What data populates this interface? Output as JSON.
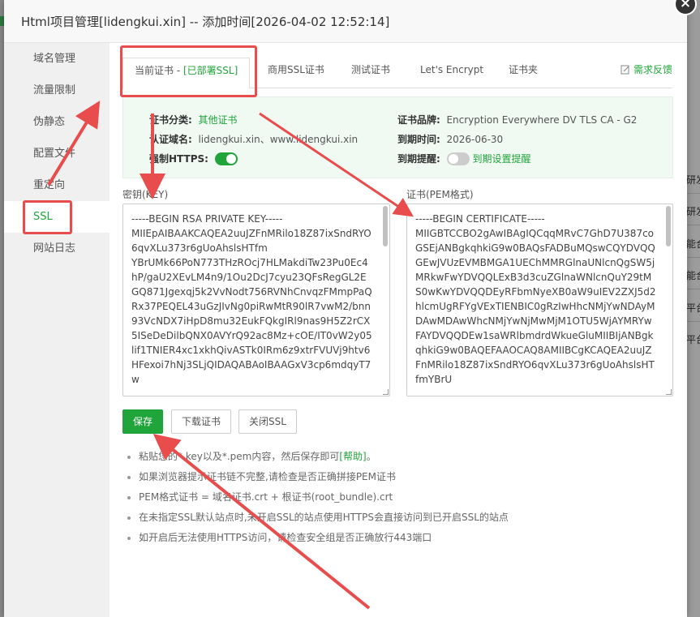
{
  "dialog": {
    "title": "Html项目管理[lidengkui.xin] -- 添加时间[2026-04-02 12:52:14]",
    "close_symbol": "×"
  },
  "sidebar": {
    "items": [
      {
        "label": "域名管理"
      },
      {
        "label": "流量限制"
      },
      {
        "label": "伪静态"
      },
      {
        "label": "配置文件"
      },
      {
        "label": "重定向"
      },
      {
        "label": "SSL"
      },
      {
        "label": "网站日志"
      }
    ],
    "active_index": 5
  },
  "tabs": {
    "current_prefix": "当前证书 - ",
    "current_status": "[已部署SSL]",
    "items": [
      {
        "label": "商用SSL证书"
      },
      {
        "label": "测试证书"
      },
      {
        "label": "Let's Encrypt"
      },
      {
        "label": "证书夹"
      }
    ],
    "feedback": "需求反馈"
  },
  "cert_info": {
    "category_label": "证书分类:",
    "category_value": "其他证书",
    "brand_label": "证书品牌:",
    "brand_value": "Encryption Everywhere DV TLS CA - G2",
    "domains_label": "认证域名:",
    "domains_value": "lidengkui.xin、www.lidengkui.xin",
    "expiry_label": "到期时间:",
    "expiry_value": "2026-06-30",
    "force_https_label": "强制HTTPS:",
    "force_https_on": true,
    "reminder_label": "到期提醒:",
    "reminder_on": false,
    "reminder_link": "到期设置提醒"
  },
  "key_field": {
    "label": "密钥(KEY)",
    "content": "-----BEGIN RSA PRIVATE KEY-----\nMIIEpAIBAAKCAQEA2uuJZFnMRilo18Z87ixSndRYO6qvXLu373r6gUoAhslsHTfm\nYBrUMk66PoN773THzROcj7HLMakdiTw23Pu0Ec4hP/gaU2XEvLM4n9/1Ou2DcJ7cyu23QFsRegGL2EGQ871Jgexqj5k2VvNodt756RVNhCnvqzFMmpPaQRx37PEQEL43uGzJIvNg0piRwMtR90lR7vwM2/bnn93VcNDX7iHpD8mu32EukFQkgIRl9nas9H5Z2rCX5ISeDeDilbQNX0AVYrQ92ac8Mz+cOE/IT0vW2y05lif1TNIER4xc1xkhQivASTk0IRm6z9xtrFVUVj9htv6HFexoi7hNj3SLjQIDAQABAoIBAAGxV3cp6mdqyT7w"
  },
  "cert_field": {
    "label": "证书(PEM格式)",
    "content": "-----BEGIN CERTIFICATE-----\nMIIGBTCCBO2gAwIBAgIQCqqMRvC7GhD7U387coGSEjANBgkqhkiG9w0BAQsFADBuMQswCQYDVQQGEwJVUzEVMBMGA1UEChMMRGlnaUNlcnQgSW5jMRkwFwYDVQQLExB3d3cuZGlnaWNlcnQuY29tMS0wKwYDVQQDEyRFbmNyeXB0aW9uIEV2ZXJ5d2hlcmUgRFYgVExTIENBIC0gRzIwHhcNMjYwNDAyMDAwMDAwWhcNMjYwNjMwMjM1OTU5WjAYMRYwFAYDVQQDEw1saWRlbmdrdWkueGluMIIBIjANBgkqhkiG9w0BAQEFAAOCAQ8AMIIBCgKCAQEA2uuJZFnMRilo18Z87ixSndRYO6qvXLu373r6gUoAhslsHTfmYBrU"
  },
  "buttons": {
    "save": "保存",
    "download": "下载证书",
    "close_ssl": "关闭SSL"
  },
  "tips": {
    "tip1_text": "粘贴您的*.key以及*.pem内容，然后保存即可",
    "tip1_link": "[帮助]",
    "tip1_end": "。",
    "tip2": "如果浏览器提示证书链不完整,请检查是否正确拼接PEM证书",
    "tip3": "PEM格式证书 = 域名证书.crt + 根证书(root_bundle).crt",
    "tip4": "在未指定SSL默认站点时,未开启SSL的站点使用HTTPS会直接访问到已开启SSL的站点",
    "tip5": "如开启后无法使用HTTPS访问，请检查安全组是否正确放行443端口"
  },
  "background": {
    "edge_texts": [
      "研发",
      "研发",
      "能合",
      "能合",
      "平台",
      "平台"
    ]
  },
  "colors": {
    "accent": "#20a53a",
    "annotation": "#e84c4c"
  }
}
